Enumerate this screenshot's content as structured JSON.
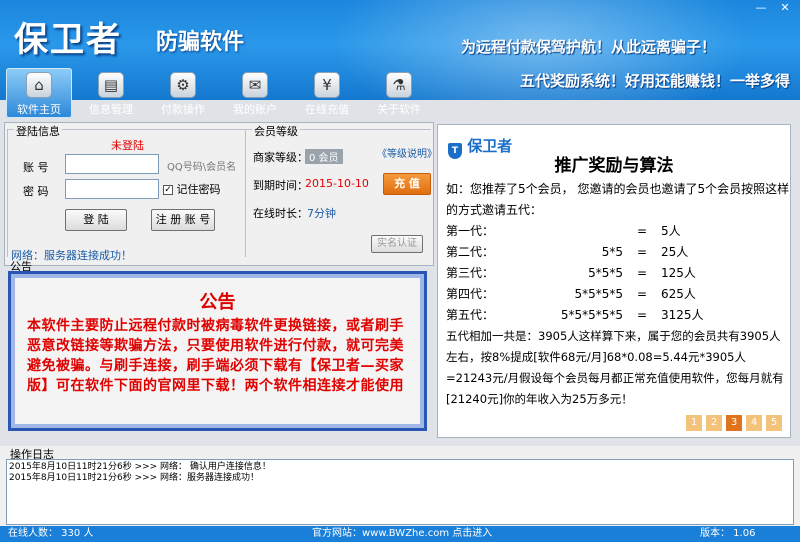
{
  "header": {
    "logo_main": "保卫者",
    "logo_sub": "防骗软件",
    "slogan1": "为远程付款保驾护航！从此远离骗子！",
    "slogan2": "五代奖励系统！好用还能赚钱！一举多得",
    "window_min": "—",
    "window_close": "✕"
  },
  "nav": [
    {
      "label": "软件主页",
      "icon": "⌂"
    },
    {
      "label": "信息管理",
      "icon": "▤"
    },
    {
      "label": "付款操作",
      "icon": "⚙"
    },
    {
      "label": "我的账户",
      "icon": "✉"
    },
    {
      "label": "在线充值",
      "icon": "¥"
    },
    {
      "label": "关于软件",
      "icon": "⚗"
    }
  ],
  "login": {
    "title": "登陆信息",
    "status": "未登陆",
    "account_label": "账  号",
    "password_label": "密  码",
    "account_hint": "QQ号码\\会员名",
    "remember_label": "记住密码",
    "login_btn": "登 陆",
    "register_btn": "注 册 账 号",
    "network_text": "网络：服务器连接成功！"
  },
  "member": {
    "title": "会员等级",
    "level_label": "商家等级：",
    "level_value": "0 会员",
    "level_link": "《等级说明》",
    "expire_label": "到期时间：",
    "expire_value": "2015-10-10",
    "recharge_btn": "充 值",
    "online_label": "在线时长：",
    "online_value": "7分钟",
    "verify_btn": "实名认证"
  },
  "notice": {
    "section_label": "公告",
    "title": "公告",
    "text": "本软件主要防止远程付款时被病毒软件更换链接，或者刷手恶意改链接等欺骗方法，只要使用软件进行付款，就可完美避免被骗。与刷手连接，刷手端必须下载有【保卫者—买家版】可在软件下面的官网里下载！两个软件相连接才能使用"
  },
  "promo": {
    "brand": "保卫者",
    "title": "推广奖励与算法",
    "intro": "如：您推荐了5个会员， 您邀请的会员也邀请了5个会员按照这样的方式邀请五代：",
    "rows": [
      {
        "gen": "第一代：",
        "expr": "",
        "eq": "=",
        "result": "5人"
      },
      {
        "gen": "第二代：",
        "expr": "5*5",
        "eq": "=",
        "result": "25人"
      },
      {
        "gen": "第三代：",
        "expr": "5*5*5",
        "eq": "=",
        "result": "125人"
      },
      {
        "gen": "第四代：",
        "expr": "5*5*5*5",
        "eq": "=",
        "result": "625人"
      },
      {
        "gen": "第五代：",
        "expr": "5*5*5*5*5",
        "eq": "=",
        "result": "3125人"
      }
    ],
    "summary": "五代相加一共是：3905人这样算下来，属于您的会员共有3905人左右，按8%提成[软件68元/月]68*0.08=5.44元*3905人=21243元/月假设每个会员每月都正常充值使用软件，您每月就有[21240元]你的年收入为25万多元！",
    "pages": [
      "1",
      "2",
      "3",
      "4",
      "5"
    ],
    "active_page": "3"
  },
  "log": {
    "title": "操作日志",
    "lines": [
      "2015年8月10日11时21分6秒  >>>  网络： 确认用户连接信息！",
      "2015年8月10日11时21分6秒  >>>  网络：服务器连接成功！"
    ]
  },
  "status": {
    "online": "在线人数：  330 人",
    "site": "官方网站：www.BWZhe.com  点击进入",
    "version": "版本：  1.06"
  },
  "colors": {
    "header_blue": "#1a86dd",
    "status_blue": "#1a7fd8",
    "alert_red": "#e00000",
    "accent_orange": "#e0741c"
  }
}
